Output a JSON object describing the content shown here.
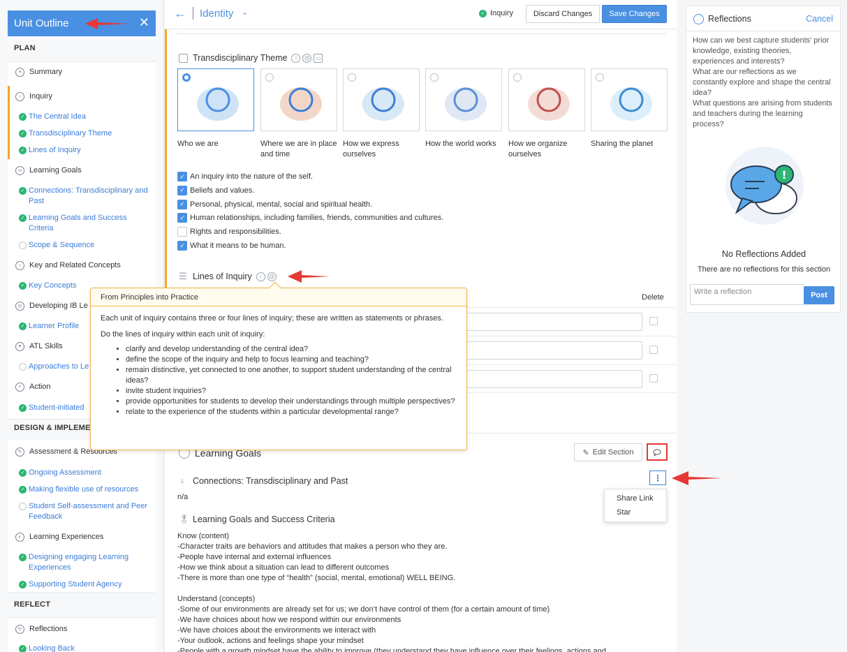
{
  "sidebar": {
    "title": "Unit Outline",
    "close": "✕",
    "sections": {
      "plan": "PLAN",
      "design": "DESIGN & IMPLEMENT",
      "reflect": "REFLECT"
    },
    "items": {
      "summary": "Summary",
      "inquiry": "Inquiry",
      "central_idea": "The Central Idea",
      "trans_theme": "Transdisciplinary Theme",
      "lines_of_inquiry": "Lines of Inquiry",
      "learning_goals": "Learning Goals",
      "connections": "Connections: Transdisciplinary and Past",
      "lg_success": "Learning Goals and Success Criteria",
      "scope": "Scope & Sequence",
      "key_concepts_group": "Key and Related Concepts",
      "key_concepts": "Key Concepts",
      "developing_ib": "Developing IB Le",
      "learner_profile": "Learner Profile",
      "atl": "ATL Skills",
      "approaches": "Approaches to Le",
      "action": "Action",
      "student_initiated": "Student-initiated",
      "assessment": "Assessment & Resources",
      "ongoing": "Ongoing Assessment",
      "flexible": "Making flexible use of resources",
      "self_assessment": "Student Self-assessment and Peer Feedback",
      "learning_exp": "Learning Experiences",
      "designing": "Designing engaging Learning Experiences",
      "supporting": "Supporting Student Agency",
      "reflections": "Reflections",
      "looking_back": "Looking Back"
    }
  },
  "topbar": {
    "back": "←",
    "title": "Identity",
    "status": "Inquiry",
    "discard": "Discard Changes",
    "save": "Save Changes"
  },
  "theme": {
    "title": "Transdisciplinary Theme",
    "cards": [
      {
        "label": "Who we are",
        "selected": true
      },
      {
        "label": "Where we are in place and time",
        "selected": false
      },
      {
        "label": "How we express ourselves",
        "selected": false
      },
      {
        "label": "How the world works",
        "selected": false
      },
      {
        "label": "How we organize ourselves",
        "selected": false
      },
      {
        "label": "Sharing the planet",
        "selected": false
      }
    ],
    "checks": [
      {
        "label": "An inquiry into the nature of the self.",
        "checked": true
      },
      {
        "label": "Beliefs and values.",
        "checked": true
      },
      {
        "label": "Personal, physical, mental, social and spiritual health.",
        "checked": true
      },
      {
        "label": "Human relationships, including families, friends, communities and cultures.",
        "checked": true
      },
      {
        "label": "Rights and responsibilities.",
        "checked": false
      },
      {
        "label": "What it means to be human.",
        "checked": true
      }
    ]
  },
  "loi": {
    "title": "Lines of Inquiry",
    "delete_header": "Delete"
  },
  "tooltip": {
    "title": "From Principles into Practice",
    "p1": "Each unit of inquiry contains three or four lines of inquiry; these are written as statements or phrases.",
    "p2": "Do the lines of inquiry within each unit of inquiry:",
    "bullets": [
      "clarify and develop understanding of the central idea?",
      "define the scope of the inquiry and help to focus learning and teaching?",
      "remain distinctive, yet connected to one another, to support student understanding of the central ideas?",
      "invite student inquiries?",
      "provide opportunities for students to develop their understandings through multiple perspectives?",
      "relate to the experience of the students within a particular developmental range?"
    ]
  },
  "learning_goals": {
    "title": "Learning Goals",
    "edit": "Edit Section",
    "connections_title": "Connections: Transdisciplinary and Past",
    "connections_value": "n/a",
    "lg_title": "Learning Goals and Success Criteria",
    "menu": {
      "share": "Share Link",
      "star": "Star"
    },
    "body": [
      "Know (content)",
      "-Character traits are behaviors and attitudes that makes a person who they are.",
      "-People have internal and external influences",
      "-How we think about a situation can lead to different outcomes",
      "-There is more than one type of “health” (social, mental, emotional) WELL BEING.",
      "",
      "Understand (concepts)",
      "-Some of our environments are already set for us; we don’t have control of them (for a certain amount of time)",
      "-We have choices about how we respond within our environments",
      "-We have choices about the environments we interact with",
      "-Your outlook, actions and feelings shape your mindset",
      "-People with a growth mindset have the ability to improve (they understand they have influence over their feelings, actions and"
    ]
  },
  "reflections": {
    "title": "Reflections",
    "cancel": "Cancel",
    "questions": "How can we best capture students' prior knowledge, existing theories, experiences and interests?\nWhat are our reflections as we constantly explore and shape the central idea?\nWhat questions are arising from students and teachers during the learning process?",
    "empty_title": "No Reflections Added",
    "empty_sub": "There are no reflections for this section",
    "input_placeholder": "Write a reflection",
    "post": "Post"
  },
  "colors": {
    "accent": "#4a90e2",
    "success": "#2bb673",
    "warning": "#f5a623",
    "annotation": "#e53935"
  }
}
